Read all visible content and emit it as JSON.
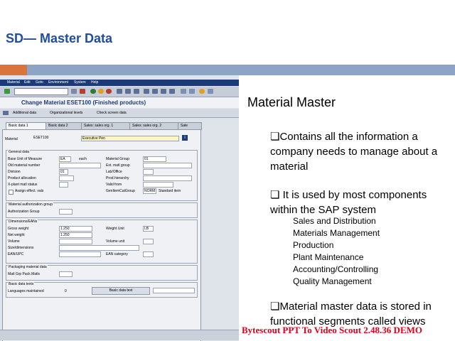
{
  "slide": {
    "title": "SD— Master Data"
  },
  "sap": {
    "menu": [
      "Material",
      "Edit",
      "Goto",
      "Environment",
      "System",
      "Help"
    ],
    "window_title": "Change Material ESET100 (Finished products)",
    "app_toolbar": [
      "Additional data",
      "Organizational levels",
      "Check screen data"
    ],
    "tabs": [
      "Basic data 1",
      "Basic data 2",
      "Sales: sales org. 1",
      "Sales: sales org. 2",
      "Sale"
    ],
    "material_label": "Material",
    "material_value": "ESET100",
    "material_desc": "Executive Pen",
    "general_data": {
      "title": "General data",
      "base_uom_label": "Base Unit of Measure",
      "base_uom_value": "EA",
      "base_uom_text": "each",
      "old_material_label": "Old material number",
      "division_label": "Division",
      "division_value": "01",
      "product_alloc_label": "Product allocation",
      "xplant_label": "X-plant matl status",
      "assign_label": "Assign effect. vals",
      "material_group_label": "Material Group",
      "material_group_value": "01",
      "ext_matl_group_label": "Ext. matl group",
      "lab_office_label": "Lab/Office",
      "prod_hierarchy_label": "Prod.hierarchy",
      "valid_from_label": "Valid from",
      "gen_item_cat_label": "GenItemCatGroup",
      "gen_item_cat_value": "NORM",
      "gen_item_cat_text": "Standard item"
    },
    "auth_group": {
      "title": "Material authorization group",
      "label": "Authorization Group"
    },
    "dimensions": {
      "title": "Dimensions/EANs",
      "gross_label": "Gross weight",
      "gross_value": "1.250",
      "net_label": "Net weight",
      "net_value": "1.250",
      "volume_label": "Volume",
      "size_label": "Size/dimensions",
      "ean_label": "EAN/UPC",
      "weight_unit_label": "Weight Unit",
      "weight_unit_value": "LB",
      "volume_unit_label": "Volume unit",
      "ean_cat_label": "EAN category"
    },
    "packaging": {
      "title": "Packaging material data",
      "label": "Matl Grp Pack.Matls"
    },
    "basic_texts": {
      "title": "Basic data texts",
      "languages_label": "Languages maintained",
      "languages_value": "0",
      "button_label": "Basic data text"
    }
  },
  "content": {
    "heading": "Material Master",
    "bullet1": "❏Contains all the information a company needs to manage about a material",
    "bullet2": "❏ It is used by most components within the SAP system",
    "sub_items": [
      "Sales and Distribution",
      "Materials Management",
      "Production",
      "Plant Maintenance",
      "Accounting/Controlling",
      "Quality Management"
    ],
    "bullet3": "❏Material master data is stored in functional segments called views"
  },
  "watermark": "Bytescout PPT To Video Scout 2.48.36 DEMO",
  "colors": {
    "title_blue": "#1f4e9c",
    "accent_orange": "#d9743c",
    "band_blue": "#8ea4c6",
    "sap_navy": "#1d3a78",
    "watermark_red": "#e2001a"
  }
}
